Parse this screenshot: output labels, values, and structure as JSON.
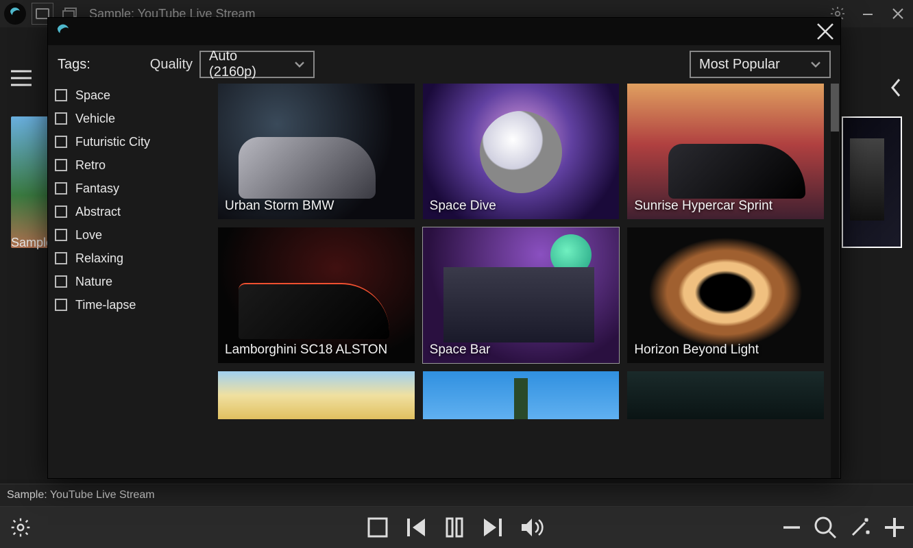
{
  "window": {
    "title": "Sample: YouTube Live Stream"
  },
  "background": {
    "left_thumb_label": "Sample"
  },
  "status": {
    "text": "Sample: YouTube Live Stream"
  },
  "modal": {
    "tags_header": "Tags:",
    "quality_label": "Quality",
    "quality_value": "Auto (2160p)",
    "sort_value": "Most Popular",
    "tags": [
      "Space",
      "Vehicle",
      "Futuristic City",
      "Retro",
      "Fantasy",
      "Abstract",
      "Love",
      "Relaxing",
      "Nature",
      "Time-lapse"
    ],
    "items": [
      {
        "title": "Urban Storm BMW"
      },
      {
        "title": "Space Dive"
      },
      {
        "title": "Sunrise Hypercar Sprint"
      },
      {
        "title": "Lamborghini SC18 ALSTON"
      },
      {
        "title": "Space Bar"
      },
      {
        "title": "Horizon Beyond Light"
      }
    ],
    "selected_index": 4
  }
}
